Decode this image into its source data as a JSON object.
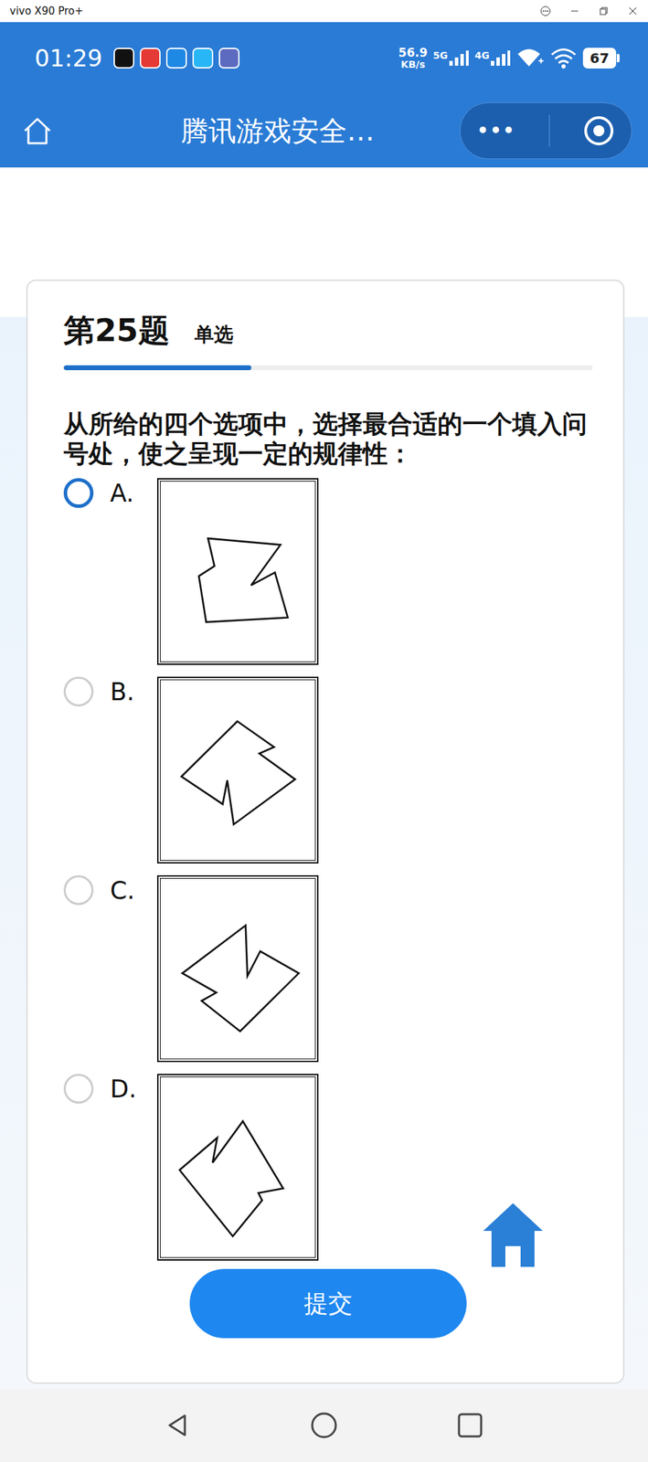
{
  "window": {
    "title": "vivo X90 Pro+"
  },
  "status_bar": {
    "time": "01:29",
    "speed": "56.9",
    "speed_unit": "KB/s",
    "networks": [
      "5G",
      "4G"
    ],
    "battery": "67"
  },
  "nav": {
    "title": "腾讯游戏安全…",
    "more": "•••"
  },
  "question": {
    "number": "第25题",
    "type": "单选",
    "progress": {
      "level": 0.355
    },
    "text": "从所给的四个选项中，选择最合适的一个填入问号处，使之呈现一定的规律性："
  },
  "options": [
    {
      "label": "A.",
      "selected": true
    },
    {
      "label": "B.",
      "selected": false
    },
    {
      "label": "C.",
      "selected": false
    },
    {
      "label": "D.",
      "selected": false
    }
  ],
  "submit": "提交"
}
